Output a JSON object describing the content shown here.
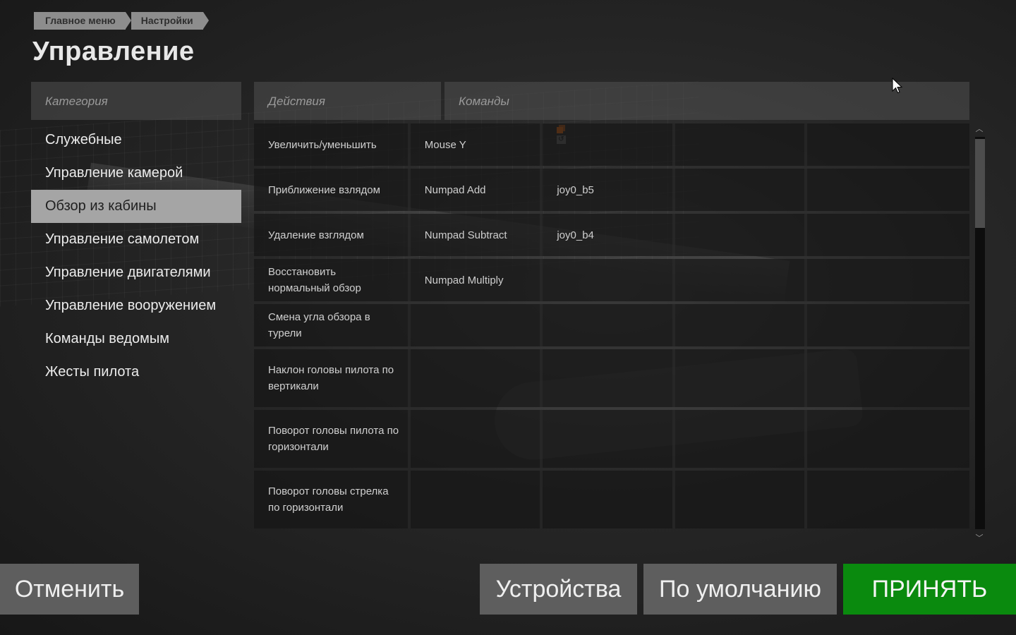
{
  "breadcrumb": [
    "Главное меню",
    "Настройки"
  ],
  "page_title": "Управление",
  "headers": {
    "category": "Категория",
    "actions": "Действия",
    "commands": "Команды"
  },
  "categories": [
    "Служебные",
    "Управление камерой",
    "Обзор из кабины",
    "Управление самолетом",
    "Управление двигателями",
    "Управление вооружением",
    "Команды ведомым",
    "Жесты пилота"
  ],
  "active_category": "Обзор из кабины",
  "bindings": [
    {
      "action": "Увеличить/уменьшить",
      "commands": [
        "Mouse Y",
        "",
        "",
        ""
      ]
    },
    {
      "action": "Приближение взлядом",
      "commands": [
        "Numpad Add",
        "joy0_b5",
        "",
        ""
      ]
    },
    {
      "action": "Удаление взглядом",
      "commands": [
        "Numpad Subtract",
        "joy0_b4",
        "",
        ""
      ]
    },
    {
      "action": "Восстановить нормальный обзор",
      "commands": [
        "Numpad Multiply",
        "",
        "",
        ""
      ]
    },
    {
      "action": "Смена угла обзора в турели",
      "commands": [
        "",
        "",
        "",
        ""
      ]
    },
    {
      "action": "Наклон головы пилота по вертикали",
      "commands": [
        "",
        "",
        "",
        ""
      ]
    },
    {
      "action": "Поворот головы пилота по горизонтали",
      "commands": [
        "",
        "",
        "",
        ""
      ]
    },
    {
      "action": "Поворот головы стрелка по горизонтали",
      "commands": [
        "",
        "",
        "",
        ""
      ]
    }
  ],
  "buttons": {
    "cancel": "Отменить",
    "devices": "Устройства",
    "default": "По умолчанию",
    "accept": "ПРИНЯТЬ"
  },
  "icons": {
    "modifier": "modifier-icon",
    "reset": "reset-icon",
    "scroll_up": "chevron-up-icon",
    "scroll_down": "chevron-down-icon",
    "cursor": "mouse-cursor-icon"
  },
  "colors": {
    "accept": "#0a8a0e",
    "active_category": "#a5a5a5",
    "modifier": "#e36a13",
    "button": "#5e5e5e"
  },
  "scrollbar": {
    "position_fraction": 0.0,
    "visible_fraction": 0.22
  }
}
